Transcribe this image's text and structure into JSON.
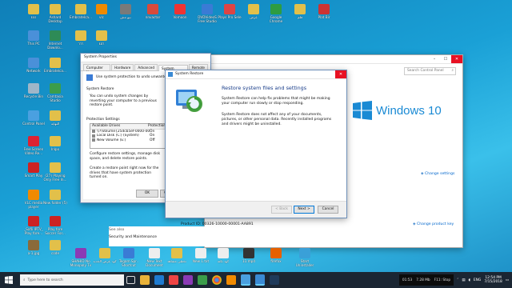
{
  "colors": {
    "accent": "#0078d7",
    "link": "#0066cc",
    "taskbar": "#1b2633",
    "close": "#e81123"
  },
  "desktop_icons": [
    {
      "label": "٤٤٤",
      "color": "#e2c04a"
    },
    {
      "label": "Ashard Desktop",
      "color": "#e2c04a"
    },
    {
      "label": "Embratelca...",
      "color": "#e2c04a"
    },
    {
      "label": "vlc",
      "color": "#f08a00"
    },
    {
      "label": "نيو مش",
      "color": "#7a7a7a"
    },
    {
      "label": "nnvactor",
      "color": "#d84a3a"
    },
    {
      "label": "Vomoon",
      "color": "#e33"
    },
    {
      "label": "DVDVideoS Free Studio",
      "color": "#3a7bd5"
    },
    {
      "label": "Plays Pro Sele",
      "color": "#d44"
    },
    {
      "label": "عرض",
      "color": "#e2c04a"
    },
    {
      "label": "Google Chrome",
      "color": "#2e9c42"
    },
    {
      "label": "فلم",
      "color": "#e2c04a"
    },
    {
      "label": "Plat Bir",
      "color": "#c33"
    },
    {
      "label": "This PC",
      "color": "#4a90d9"
    },
    {
      "label": "Internet Downlo...",
      "color": "#2e8b57"
    },
    {
      "label": "٦٦٦",
      "color": "#e2c04a"
    },
    {
      "label": "٤٥٦",
      "color": "#e2c04a"
    },
    {
      "label": "Network",
      "color": "#4a90d9"
    },
    {
      "label": "Embratelca...",
      "color": "#e2c04a"
    },
    {
      "label": "Recycle Bin",
      "color": "#9fb6c8"
    },
    {
      "label": "Camtasia Studio",
      "color": "#3b9d4a"
    },
    {
      "label": "Control Panel",
      "color": "#4aa0e0"
    },
    {
      "label": "النهاية",
      "color": "#e2c04a"
    },
    {
      "label": "Free Screen Video Re...",
      "color": "#d23"
    },
    {
      "label": "Inlpo",
      "color": "#e2c04a"
    },
    {
      "label": "Smart Play",
      "color": "#c22"
    },
    {
      "label": "(27) Playing Only Free In...",
      "color": "#e2c04a"
    },
    {
      "label": "VLC media player",
      "color": "#f08a00"
    },
    {
      "label": "New folder (5)",
      "color": "#e2c04a"
    },
    {
      "label": "_Safii IPTV_ Play fore...",
      "color": "#c22"
    },
    {
      "label": "Play fore Soccer For...",
      "color": "#c22"
    },
    {
      "label": "a-1.jpg",
      "color": "#8a6a3a"
    },
    {
      "label": "code",
      "color": "#e2c04a"
    }
  ],
  "dialog_sysprops": {
    "title": "System Properties",
    "tabs": [
      "Computer Name",
      "Hardware",
      "Advanced",
      "System Protection",
      "Remote"
    ],
    "intro": "Use system protection to undo unwanted system changes.",
    "sr_heading": "System Restore",
    "sr_text": "You can undo system changes by reverting your computer to a previous restore point.",
    "ps_heading": "Protection Settings",
    "col_drives": "Available Drives",
    "col_protection": "Protection",
    "drives": [
      {
        "name": "\\\\?\\Volume{25dcb5ef-0000-0000...",
        "protection": "On"
      },
      {
        "name": "Local Disk (C:) (System)",
        "protection": "On"
      },
      {
        "name": "New Volume (E:)",
        "protection": "Off"
      }
    ],
    "configure_text": "Configure restore settings, manage disk space, and delete restore points.",
    "create_text": "Create a restore point right now for the drives that have system protection turned on.",
    "ok_label": "OK",
    "cancel_label": "Ca"
  },
  "dialog_restore": {
    "title": "System Restore",
    "heading": "Restore system files and settings",
    "p1": "System Restore can help fix problems that might be making your computer run slowly or stop responding.",
    "p2": "System Restore does not affect any of your documents, pictures, or other personal data. Recently installed programs and drivers might be uninstalled.",
    "back_label": "< Back",
    "next_label": "Next >",
    "cancel_label": "Cancel"
  },
  "control_panel": {
    "search_placeholder": "Search Control Panel",
    "windows_logo_text": "Windows 10",
    "change_settings": "Change settings",
    "product_id": "Product ID: 00326-10000-00001-AA891",
    "change_product_key": "Change product key",
    "see_also": "See also",
    "security_maintenance": "Security and Maintenance"
  },
  "bottom_icons": [
    {
      "label": "SHAHID No Monopoly Tv",
      "color": "#8a3ab5"
    },
    {
      "label": "كود عرض الجديد",
      "color": "#e2c04a"
    },
    {
      "label": "Tegam Spr.. Shortcut",
      "color": "#3a7bd5"
    },
    {
      "label": "New Text Document",
      "color": "#eee"
    },
    {
      "label": "تخطى مشاهد",
      "color": "#e2c04a"
    },
    {
      "label": "New 1.txt",
      "color": "#eee"
    },
    {
      "label": "كود نكتة",
      "color": "#eee"
    },
    {
      "label": "11.mp4",
      "color": "#333"
    },
    {
      "label": "firefox",
      "color": "#e66000"
    },
    {
      "label": "Start Uninstaller",
      "color": "#3aa0d8"
    }
  ],
  "taskbar": {
    "search_placeholder": "Type here to search",
    "recorder_time": "01:53",
    "recorder_size": "7.28 Mb",
    "recorder_stop": "F11: Stop",
    "lang": "ENG",
    "time": "12:54 PM",
    "date": "7/15/2018"
  }
}
